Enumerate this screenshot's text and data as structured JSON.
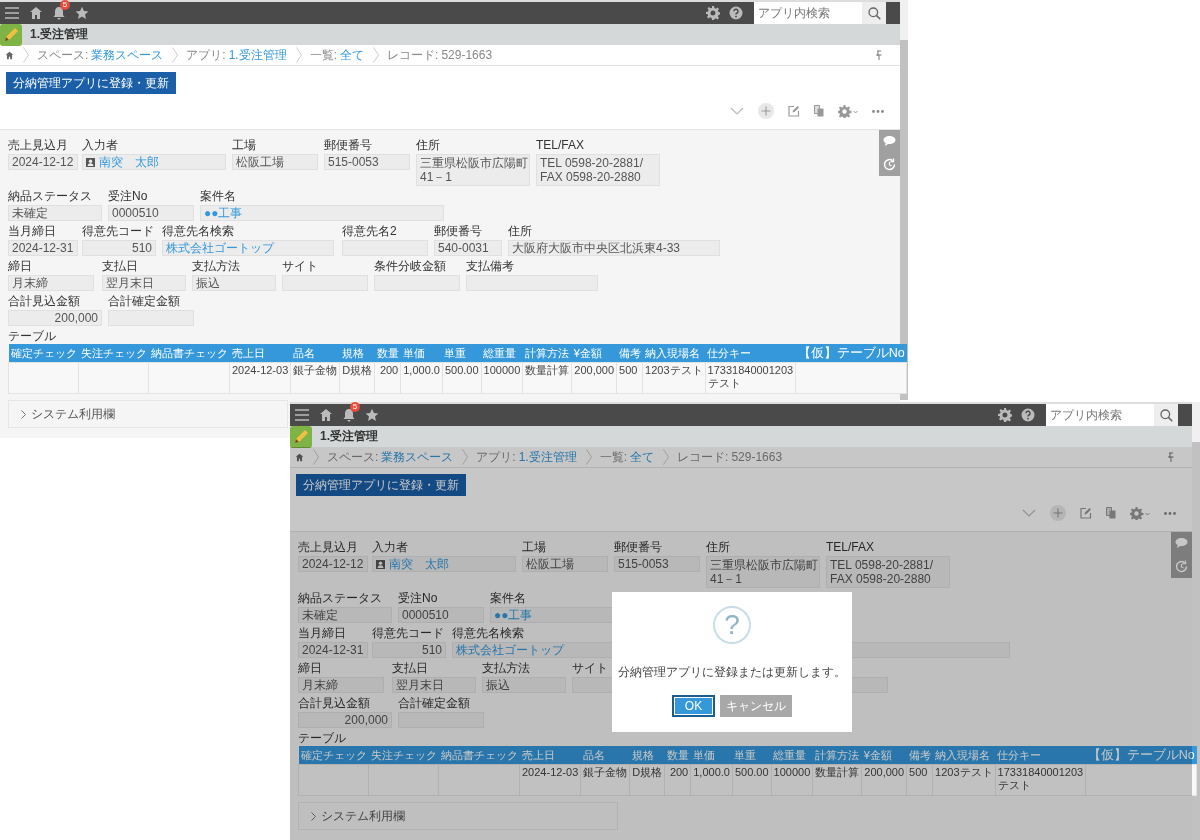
{
  "screens": [
    {
      "topbar": {
        "notification_count": "5",
        "search": {
          "placeholder": "アプリ内検索"
        }
      },
      "app_title": "1.受注管理",
      "breadcrumb": [
        {
          "label": "スペース:",
          "value": "業務スペース",
          "link": true
        },
        {
          "label": "アプリ:",
          "value": "1.受注管理",
          "link": true
        },
        {
          "label": "一覧:",
          "value": "全て",
          "link": true
        },
        {
          "label": "レコード:",
          "value": "529-1663",
          "link": false
        }
      ],
      "action_button": "分納管理アプリに登録・更新",
      "form_rows": [
        [
          {
            "label": "売上見込月",
            "kind": "text",
            "value": "2024-12-12"
          },
          {
            "label": "入力者",
            "kind": "user",
            "value": "南突　太郎"
          },
          {
            "label": "工場",
            "kind": "text",
            "value": "松阪工場"
          },
          {
            "label": "郵便番号",
            "kind": "text",
            "value": "515-0053"
          },
          {
            "label": "住所",
            "kind": "lines",
            "lines": [
              "三重県松阪市広陽町",
              "41－1"
            ]
          },
          {
            "label": "TEL/FAX",
            "kind": "lines",
            "lines": [
              "TEL  0598-20-2881/",
              "FAX  0598-20-2880"
            ]
          }
        ],
        [
          {
            "label": "納品ステータス",
            "kind": "text",
            "value": "未確定"
          },
          {
            "label": "受注No",
            "kind": "text",
            "value": "0000510"
          },
          {
            "label": "案件名",
            "kind": "link",
            "value": "●●工事"
          }
        ],
        [
          {
            "label": "当月締日",
            "kind": "text",
            "value": "2024-12-31"
          },
          {
            "label": "得意先コード",
            "kind": "number",
            "value": "510"
          },
          {
            "label": "得意先名検索",
            "kind": "link",
            "value": "株式会社ゴートップ"
          },
          {
            "label": "得意先名2",
            "kind": "text"
          },
          {
            "label": "郵便番号",
            "kind": "text",
            "value": "540-0031"
          },
          {
            "label": "住所",
            "kind": "text",
            "value": "大阪府大阪市中央区北浜東4-33"
          }
        ],
        [
          {
            "label": "締日",
            "kind": "text",
            "value": "月末締"
          },
          {
            "label": "支払日",
            "kind": "text",
            "value": "翌月末日"
          },
          {
            "label": "支払方法",
            "kind": "text",
            "value": "振込"
          },
          {
            "label": "サイト",
            "kind": "text"
          },
          {
            "label": "条件分岐金額",
            "kind": "text"
          },
          {
            "label": "支払備考",
            "kind": "text"
          }
        ],
        [
          {
            "label": "合計見込金額",
            "kind": "number",
            "value": "200,000"
          },
          {
            "label": "合計確定金額",
            "kind": "number"
          }
        ]
      ],
      "table": {
        "label": "テーブル",
        "columns": [
          "確定チェック",
          "失注チェック",
          "納品書チェック",
          "売上日",
          "品名",
          "規格",
          "数量",
          "単価",
          "単重",
          "総重量",
          "計算方法",
          "¥金額",
          "備考",
          "納入現場名",
          "仕分キー",
          "【仮】テーブルNo"
        ],
        "rows": [
          {
            "cells": [
              {},
              {},
              {},
              {
                "text": "2024-12-03"
              },
              {
                "text": "銀子金物"
              },
              {
                "text": "D規格"
              },
              {
                "text": "200",
                "kind": "number"
              },
              {
                "text": "1,000.0",
                "kind": "number"
              },
              {
                "text": "500.00",
                "kind": "number"
              },
              {
                "text": "100000",
                "kind": "number"
              },
              {
                "text": "数量計算"
              },
              {
                "text": "200,000",
                "kind": "number"
              },
              {
                "text": "500"
              },
              {
                "text": "1203テスト"
              },
              {
                "text": "17331840001203テスト"
              },
              {}
            ]
          }
        ]
      },
      "section": {
        "label": "システム利用欄",
        "expanded": false
      }
    },
    {
      "topbar": {
        "notification_count": "5",
        "search": {
          "placeholder": "アプリ内検索"
        }
      },
      "app_title": "1.受注管理",
      "breadcrumb": [
        {
          "label": "スペース:",
          "value": "業務スペース",
          "link": true
        },
        {
          "label": "アプリ:",
          "value": "1.受注管理",
          "link": true
        },
        {
          "label": "一覧:",
          "value": "全て",
          "link": true
        },
        {
          "label": "レコード:",
          "value": "529-1663",
          "link": false
        }
      ],
      "action_button": "分納管理アプリに登録・更新",
      "form_rows": [
        [
          {
            "label": "売上見込月",
            "kind": "text",
            "value": "2024-12-12"
          },
          {
            "label": "入力者",
            "kind": "user",
            "value": "南突　太郎"
          },
          {
            "label": "工場",
            "kind": "text",
            "value": "松阪工場"
          },
          {
            "label": "郵便番号",
            "kind": "text",
            "value": "515-0053"
          },
          {
            "label": "住所",
            "kind": "lines",
            "lines": [
              "三重県松阪市広陽町",
              "41－1"
            ]
          },
          {
            "label": "TEL/FAX",
            "kind": "lines",
            "lines": [
              "TEL  0598-20-2881/",
              "FAX  0598-20-2880"
            ]
          }
        ],
        [
          {
            "label": "納品ステータス",
            "kind": "text",
            "value": "未確定"
          },
          {
            "label": "受注No",
            "kind": "text",
            "value": "0000510"
          },
          {
            "label": "案件名",
            "kind": "link",
            "value": "●●工事"
          }
        ],
        [
          {
            "label": "当月締日",
            "kind": "text",
            "value": "2024-12-31"
          },
          {
            "label": "得意先コード",
            "kind": "number",
            "value": "510"
          },
          {
            "label": "得意先名検索",
            "kind": "link",
            "value": "株式会社ゴートップ"
          },
          {
            "kind": "hidden"
          },
          {
            "kind": "hidden"
          },
          {
            "kind": "covered"
          }
        ],
        [
          {
            "label": "締日",
            "kind": "text",
            "value": "月末締"
          },
          {
            "label": "支払日",
            "kind": "text",
            "value": "翌月末日"
          },
          {
            "label": "支払方法",
            "kind": "text",
            "value": "振込"
          },
          {
            "label": "サイト",
            "kind": "text"
          },
          {
            "kind": "hidden"
          },
          {
            "kind": "covered"
          }
        ],
        [
          {
            "label": "合計見込金額",
            "kind": "number",
            "value": "200,000"
          },
          {
            "label": "合計確定金額",
            "kind": "number"
          }
        ]
      ],
      "table": {
        "label": "テーブル",
        "columns": [
          "確定チェック",
          "失注チェック",
          "納品書チェック",
          "売上日",
          "品名",
          "規格",
          "数量",
          "単価",
          "単重",
          "総重量",
          "計算方法",
          "¥金額",
          "備考",
          "納入現場名",
          "仕分キー",
          "【仮】テーブルNo"
        ],
        "rows": [
          {
            "cells": [
              {},
              {},
              {},
              {
                "text": "2024-12-03"
              },
              {
                "text": "銀子金物"
              },
              {
                "text": "D規格"
              },
              {
                "text": "200",
                "kind": "number"
              },
              {
                "text": "1,000.0",
                "kind": "number"
              },
              {
                "text": "500.00",
                "kind": "number"
              },
              {
                "text": "100000",
                "kind": "number"
              },
              {
                "text": "数量計算"
              },
              {
                "text": "200,000",
                "kind": "number"
              },
              {
                "text": "500"
              },
              {
                "text": "1203テスト"
              },
              {
                "text": "17331840001203テスト"
              },
              {}
            ]
          }
        ]
      },
      "section": {
        "label": "システム利用欄",
        "expanded": false
      },
      "dialog": {
        "symbol": "?",
        "message": "分納管理アプリに登録または更新します。",
        "buttons": [
          {
            "label": "OK",
            "kind": "primary",
            "focused": true
          },
          {
            "label": "キャンセル",
            "kind": "secondary",
            "focused": false
          }
        ]
      }
    }
  ]
}
